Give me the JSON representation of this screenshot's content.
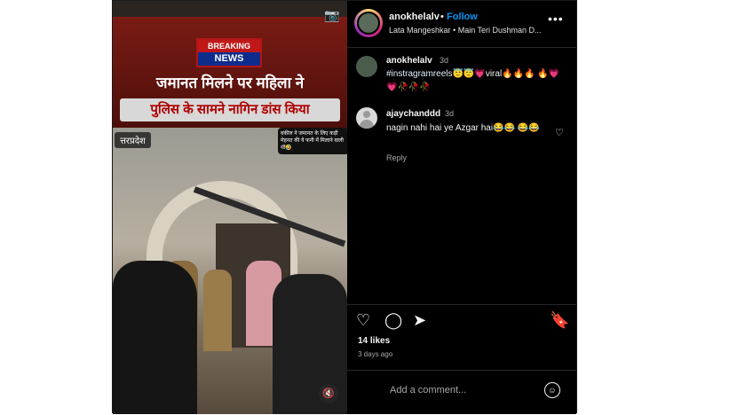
{
  "post": {
    "media": {
      "breaking_top": "BREAKING",
      "breaking_bottom": "NEWS",
      "headline_line1": "जमानत मिलने पर महिला ने",
      "headline_line2": "पुलिस के सामने नागिन डांस किया",
      "location_tag": "त्तरप्रदेश",
      "overlay_caption": "वकील ने जमानत के लिए कड़ी मेहनत की ये फनी में मिलाने वाली थी🤣"
    },
    "header": {
      "username": "anokhelalv",
      "separator": "•",
      "follow_label": "Follow",
      "audio": "Lata Mangeshkar • Main Teri Dushman D..."
    },
    "caption": {
      "username": "anokhelalv",
      "time": "3d",
      "hashtag": "#instragramreels",
      "text": "😇😇💗viral🔥🔥🔥 🔥💗💗🥀🥀🥀"
    },
    "comments": [
      {
        "username": "ajaychanddd",
        "time": "3d",
        "text": "nagin nahi hai ye Azgar hai😂😂 😂😂",
        "reply_label": "Reply"
      }
    ],
    "likes": "14 likes",
    "posted_ago": "3 days ago",
    "add_comment_placeholder": "Add a comment..."
  }
}
